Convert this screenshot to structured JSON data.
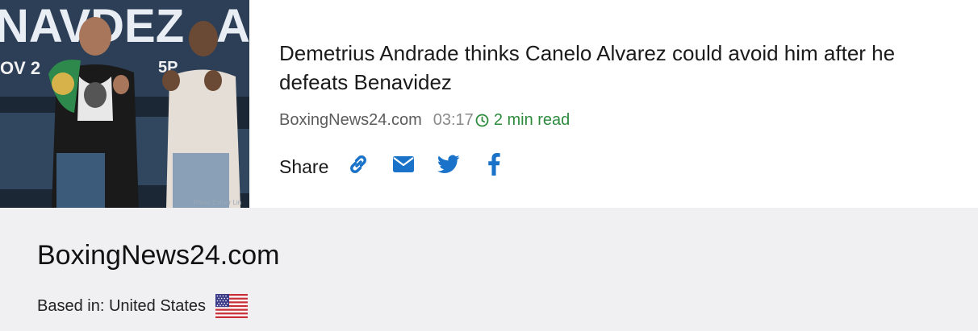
{
  "article": {
    "image_alt": "Demetrius Andrade and David Benavidez press conference",
    "headline": "Demetrius Andrade thinks Canelo Alvarez could avoid him after he defeats Benavidez",
    "source": "BoxingNews24.com",
    "time": "03:17",
    "read_time": "2 min read",
    "share_label": "Share",
    "share_icons": [
      "link-icon",
      "envelope-icon",
      "twitter-icon",
      "facebook-icon"
    ],
    "accent_color": "#1a73c8",
    "read_color": "#2e8b3e"
  },
  "publisher": {
    "name": "BoxingNews24.com",
    "based_in": "Based in: United States",
    "flag_icon": "us-flag-icon",
    "background": "#f0f0f2"
  }
}
